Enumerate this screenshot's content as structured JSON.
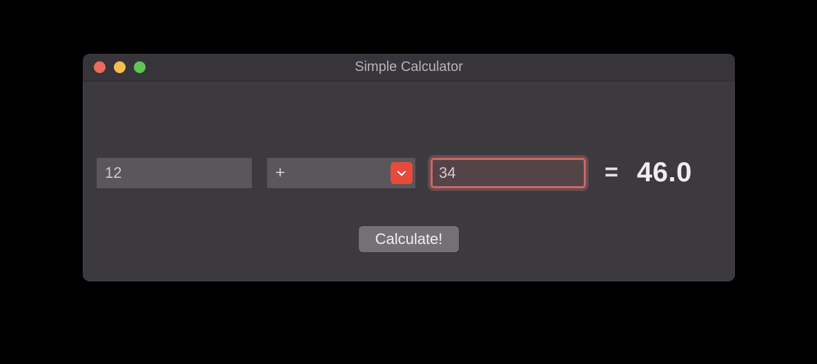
{
  "window": {
    "title": "Simple Calculator"
  },
  "inputs": {
    "operand_a": "12",
    "operator": "+",
    "operand_b": "34"
  },
  "labels": {
    "equals": "=",
    "calculate_button": "Calculate!"
  },
  "result": "46.0",
  "colors": {
    "window_bg": "#3d3a3f",
    "input_bg": "#59565c",
    "accent_red": "#e64b3c",
    "focus_ring": "#c86a67"
  }
}
